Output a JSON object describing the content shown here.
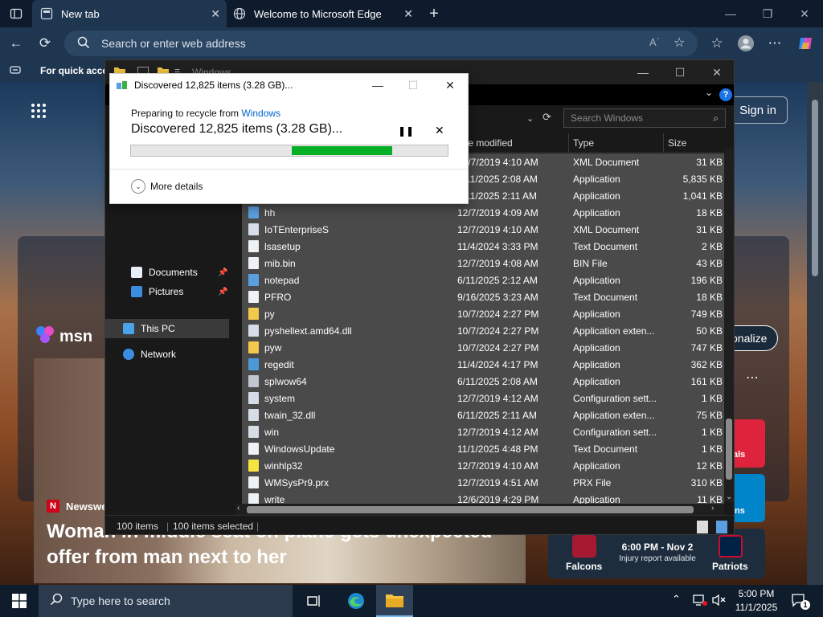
{
  "browser": {
    "tabs": [
      {
        "label": "New tab",
        "icon": "new-tab-icon"
      },
      {
        "label": "Welcome to Microsoft Edge",
        "icon": "edge-icon"
      }
    ],
    "address_placeholder": "Search or enter web address",
    "favorites_bar_text": "For quick access",
    "signin_label": "Sign in",
    "personalize_label": "onalize",
    "msn_label": "msn",
    "news": {
      "source": "Newsweek",
      "headline": "Woman in middle seat on plane gets unexpected offer from man next to her"
    },
    "sports": {
      "tile1_label": "als",
      "tile2_label": "ns",
      "time": "6:00 PM - Nov 2",
      "sub": "Injury report available",
      "team1": "Falcons",
      "team2": "Patriots"
    }
  },
  "explorer": {
    "title": "Windows",
    "search_placeholder": "Search Windows",
    "columns": {
      "date": "te modified",
      "type": "Type",
      "size": "Size"
    },
    "nav": [
      {
        "label": "Documents",
        "icon": "documents-icon",
        "pinned": true
      },
      {
        "label": "Pictures",
        "icon": "pictures-icon",
        "pinned": true
      },
      {
        "label": "This PC",
        "icon": "computer-icon",
        "pinned": false
      },
      {
        "label": "Network",
        "icon": "network-icon",
        "pinned": false
      }
    ],
    "files": [
      {
        "name": "",
        "date": "12/7/2019 4:10 AM",
        "type": "XML Document",
        "size": "31 KB",
        "kind": "xml"
      },
      {
        "name": "",
        "date": "6/11/2025 2:08 AM",
        "type": "Application",
        "size": "5,835 KB",
        "kind": "app"
      },
      {
        "name": "",
        "date": "6/11/2025 2:11 AM",
        "type": "Application",
        "size": "1,041 KB",
        "kind": "app"
      },
      {
        "name": "hh",
        "date": "12/7/2019 4:09 AM",
        "type": "Application",
        "size": "18 KB",
        "kind": "app"
      },
      {
        "name": "IoTEnterpriseS",
        "date": "12/7/2019 4:10 AM",
        "type": "XML Document",
        "size": "31 KB",
        "kind": "xml"
      },
      {
        "name": "lsasetup",
        "date": "11/4/2024 3:33 PM",
        "type": "Text Document",
        "size": "2 KB",
        "kind": "txt"
      },
      {
        "name": "mib.bin",
        "date": "12/7/2019 4:08 AM",
        "type": "BIN File",
        "size": "43 KB",
        "kind": "file"
      },
      {
        "name": "notepad",
        "date": "6/11/2025 2:12 AM",
        "type": "Application",
        "size": "196 KB",
        "kind": "notepad"
      },
      {
        "name": "PFRO",
        "date": "9/16/2025 3:23 AM",
        "type": "Text Document",
        "size": "18 KB",
        "kind": "txt"
      },
      {
        "name": "py",
        "date": "10/7/2024 2:27 PM",
        "type": "Application",
        "size": "749 KB",
        "kind": "python"
      },
      {
        "name": "pyshellext.amd64.dll",
        "date": "10/7/2024 2:27 PM",
        "type": "Application exten...",
        "size": "50 KB",
        "kind": "dll"
      },
      {
        "name": "pyw",
        "date": "10/7/2024 2:27 PM",
        "type": "Application",
        "size": "747 KB",
        "kind": "python"
      },
      {
        "name": "regedit",
        "date": "11/4/2024 4:17 PM",
        "type": "Application",
        "size": "362 KB",
        "kind": "regedit"
      },
      {
        "name": "splwow64",
        "date": "6/11/2025 2:08 AM",
        "type": "Application",
        "size": "161 KB",
        "kind": "printer"
      },
      {
        "name": "system",
        "date": "12/7/2019 4:12 AM",
        "type": "Configuration sett...",
        "size": "1 KB",
        "kind": "ini"
      },
      {
        "name": "twain_32.dll",
        "date": "6/11/2025 2:11 AM",
        "type": "Application exten...",
        "size": "75 KB",
        "kind": "dll"
      },
      {
        "name": "win",
        "date": "12/7/2019 4:12 AM",
        "type": "Configuration sett...",
        "size": "1 KB",
        "kind": "ini"
      },
      {
        "name": "WindowsUpdate",
        "date": "11/1/2025 4:48 PM",
        "type": "Text Document",
        "size": "1 KB",
        "kind": "txt"
      },
      {
        "name": "winhlp32",
        "date": "12/7/2019 4:10 AM",
        "type": "Application",
        "size": "12 KB",
        "kind": "help"
      },
      {
        "name": "WMSysPr9.prx",
        "date": "12/7/2019 4:51 AM",
        "type": "PRX File",
        "size": "310 KB",
        "kind": "file"
      },
      {
        "name": "write",
        "date": "12/6/2019 4:29 PM",
        "type": "Application",
        "size": "11 KB",
        "kind": "write"
      }
    ],
    "status": {
      "count": "100 items",
      "selected": "100 items selected"
    }
  },
  "dialog": {
    "title": "Discovered 12,825 items (3.28 GB)...",
    "from_prefix": "Preparing to recycle from ",
    "from_link": "Windows",
    "status": "Discovered 12,825 items (3.28 GB)...",
    "more_details": "More details",
    "progress_start_fraction": 0.51,
    "progress_fill_fraction": 0.32
  },
  "taskbar": {
    "search_placeholder": "Type here to search",
    "time": "5:00 PM",
    "date": "11/1/2025",
    "notification_count": "1"
  },
  "colors": {
    "edge_dark": "#0e1b2c",
    "edge_toolbar": "#1f3650",
    "explorer_bg": "#191919",
    "selection": "#4a4a4a",
    "progress_green": "#06b025",
    "link_blue": "#0066cc"
  }
}
